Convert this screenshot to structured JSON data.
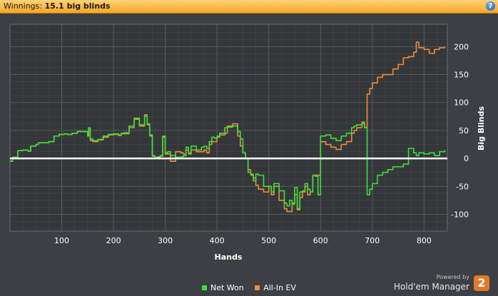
{
  "header": {
    "label": "Winnings:",
    "value": "15.1 big blinds",
    "help_icon": "?"
  },
  "branding": {
    "powered_by": "Powered by",
    "product": "Hold'em Manager",
    "badge": "2"
  },
  "colors": {
    "background": "#3c3f43",
    "plot_background": "#34373a",
    "grid": "#5a5d61",
    "net_won": "#3ee03e",
    "all_in_ev": "#f08c3a",
    "zero_line": "#ffffff",
    "header": "#f5a623"
  },
  "chart_data": {
    "type": "line",
    "xlabel": "Hands",
    "ylabel": "Big Blinds",
    "xlim": [
      0,
      845
    ],
    "ylim": [
      -130,
      240
    ],
    "xticks": [
      100,
      200,
      300,
      400,
      500,
      600,
      700,
      800
    ],
    "yticks": [
      -100,
      -50,
      0,
      50,
      100,
      150,
      200
    ],
    "grid": true,
    "legend_position": "bottom-center",
    "series": [
      {
        "name": "Net Won",
        "color": "#3ee03e",
        "x": [
          0,
          5,
          15,
          25,
          35,
          40,
          50,
          55,
          65,
          75,
          85,
          95,
          105,
          110,
          120,
          130,
          140,
          150,
          152,
          155,
          160,
          170,
          180,
          190,
          200,
          210,
          215,
          220,
          230,
          240,
          250,
          260,
          265,
          270,
          275,
          280,
          285,
          290,
          295,
          300,
          305,
          310,
          320,
          330,
          335,
          340,
          345,
          350,
          360,
          370,
          375,
          380,
          385,
          390,
          395,
          400,
          405,
          415,
          420,
          430,
          440,
          445,
          450,
          455,
          460,
          465,
          470,
          475,
          480,
          490,
          500,
          505,
          510,
          520,
          530,
          535,
          540,
          545,
          550,
          555,
          560,
          565,
          570,
          575,
          580,
          585,
          590,
          595,
          600,
          610,
          620,
          630,
          640,
          650,
          660,
          665,
          670,
          680,
          685,
          690,
          695,
          700,
          710,
          720,
          730,
          740,
          750,
          760,
          770,
          780,
          785,
          790,
          800,
          810,
          820,
          830,
          840
        ],
        "values": [
          -5,
          2,
          14,
          15,
          13,
          22,
          25,
          28,
          28,
          30,
          40,
          43,
          44,
          43,
          45,
          48,
          48,
          40,
          55,
          35,
          32,
          34,
          40,
          43,
          44,
          42,
          45,
          46,
          58,
          72,
          60,
          75,
          60,
          40,
          5,
          2,
          3,
          5,
          40,
          10,
          12,
          5,
          2,
          3,
          5,
          20,
          10,
          22,
          15,
          20,
          22,
          18,
          30,
          38,
          36,
          40,
          45,
          55,
          56,
          58,
          48,
          35,
          10,
          0,
          -25,
          -30,
          -40,
          -28,
          -30,
          -50,
          -50,
          -60,
          -45,
          -58,
          -80,
          -85,
          -75,
          -82,
          -52,
          -90,
          -60,
          -58,
          -45,
          -55,
          -60,
          -30,
          -32,
          -65,
          40,
          42,
          36,
          32,
          40,
          45,
          55,
          58,
          60,
          62,
          55,
          -65,
          -55,
          -45,
          -30,
          -25,
          -20,
          -15,
          -15,
          -10,
          18,
          10,
          5,
          10,
          8,
          10,
          5,
          12,
          15
        ]
      },
      {
        "name": "All-In EV",
        "color": "#f08c3a",
        "x": [
          0,
          5,
          15,
          25,
          35,
          40,
          50,
          55,
          65,
          75,
          85,
          95,
          105,
          110,
          120,
          130,
          140,
          150,
          152,
          155,
          160,
          170,
          180,
          190,
          200,
          210,
          215,
          220,
          230,
          240,
          250,
          260,
          265,
          270,
          275,
          280,
          285,
          290,
          295,
          300,
          305,
          310,
          320,
          330,
          335,
          340,
          345,
          350,
          360,
          370,
          375,
          380,
          385,
          390,
          395,
          400,
          405,
          415,
          420,
          430,
          440,
          445,
          450,
          455,
          460,
          465,
          470,
          475,
          480,
          490,
          500,
          505,
          510,
          520,
          530,
          535,
          540,
          545,
          550,
          555,
          560,
          565,
          570,
          575,
          580,
          585,
          590,
          595,
          600,
          610,
          620,
          630,
          640,
          650,
          660,
          665,
          670,
          680,
          685,
          690,
          695,
          700,
          710,
          720,
          730,
          740,
          750,
          760,
          770,
          780,
          785,
          790,
          800,
          810,
          820,
          830,
          840
        ],
        "values": [
          -5,
          2,
          14,
          15,
          13,
          22,
          25,
          28,
          28,
          30,
          40,
          43,
          44,
          43,
          45,
          48,
          48,
          40,
          52,
          32,
          30,
          33,
          38,
          42,
          43,
          41,
          44,
          44,
          55,
          70,
          58,
          78,
          62,
          42,
          4,
          1,
          2,
          4,
          38,
          8,
          8,
          -5,
          12,
          10,
          8,
          15,
          8,
          15,
          12,
          12,
          15,
          10,
          25,
          30,
          30,
          38,
          42,
          45,
          58,
          62,
          40,
          22,
          10,
          0,
          -20,
          -28,
          -35,
          -48,
          -55,
          -60,
          -50,
          -65,
          -50,
          -75,
          -90,
          -95,
          -95,
          -80,
          -65,
          -92,
          -70,
          -60,
          -50,
          -65,
          -60,
          -30,
          -30,
          -30,
          30,
          25,
          20,
          16,
          25,
          30,
          45,
          50,
          55,
          65,
          55,
          115,
          125,
          135,
          145,
          150,
          150,
          160,
          168,
          180,
          182,
          190,
          208,
          198,
          195,
          188,
          195,
          198,
          200
        ]
      }
    ]
  }
}
